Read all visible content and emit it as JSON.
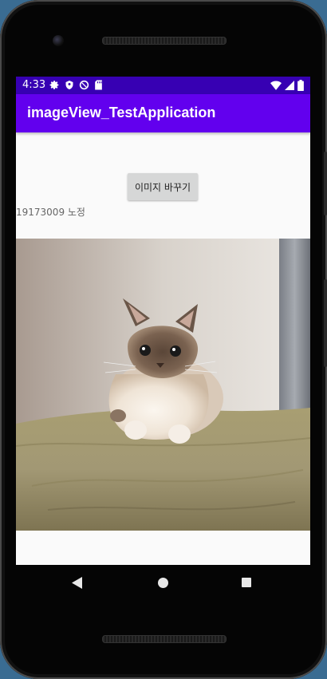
{
  "status_bar": {
    "time": "4:33",
    "left_icons": [
      "gear-icon",
      "shield-icon",
      "data-saver-icon",
      "sd-card-icon"
    ],
    "right_icons": [
      "wifi-icon",
      "cell-signal-icon",
      "battery-icon"
    ]
  },
  "app_bar": {
    "title": "imageView_TestApplication"
  },
  "main": {
    "change_image_button": "이미지 바꾸기",
    "student_text": "19173009 노정"
  },
  "nav_bar": {
    "buttons": [
      "back-icon",
      "home-icon",
      "recents-icon"
    ]
  },
  "colors": {
    "status_bar": "#3700b3",
    "app_bar": "#6200ee",
    "screen_bg": "#fafafa",
    "button_bg": "#d6d7d7"
  }
}
